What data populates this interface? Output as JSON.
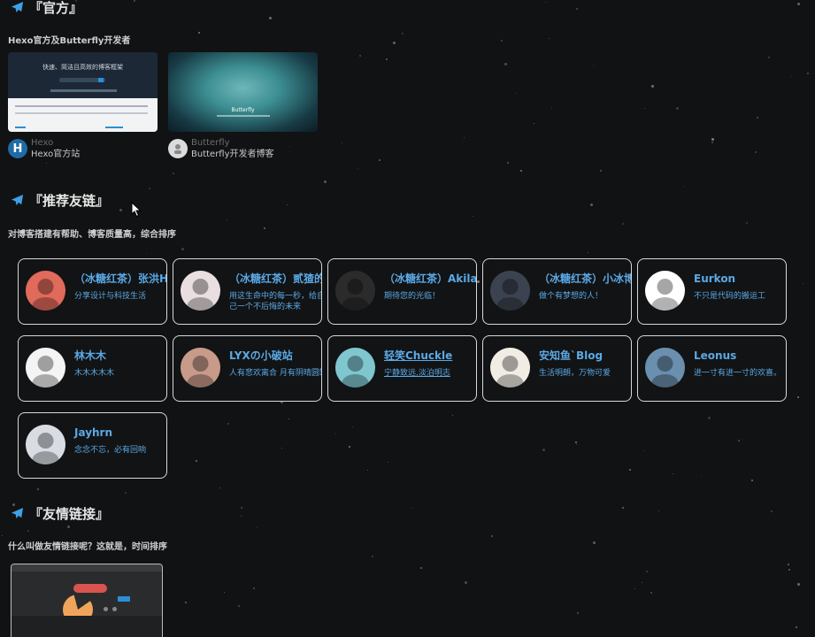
{
  "sections": {
    "official": {
      "title": "『官方』",
      "desc": "Hexo官方及Butterfly开发者",
      "cards": [
        {
          "name": "Hexo",
          "sub": "Hexo官方站",
          "thumb_heading": "快速、简洁且高效的博客框架",
          "avatar_letter": "H",
          "avatar_color": "#1f6ba5"
        },
        {
          "name": "Butterfly",
          "sub": "Butterfly开发者博客",
          "thumb_heading": "Butterfly",
          "avatar_letter": "",
          "avatar_color": "#dcdcdc"
        }
      ]
    },
    "recommended": {
      "title": "『推荐友链』",
      "desc": "对博客搭建有帮助、博客质量高，综合排序"
    },
    "friends": {
      "title": "『友情链接』",
      "desc": "什么叫做友情链接呢？这就是，时间排序"
    }
  },
  "friend_cards": [
    {
      "name": "（冰糖红茶）张洪Heo",
      "desc": "分享设计与科技生活",
      "avatar_icon": "avatar-heo-icon",
      "avatar_color": "#e06a5b"
    },
    {
      "name": "（冰糖红茶）贰猹的小窝",
      "desc": "用这生命中的每一秒，给自己一个不后悔的未来",
      "avatar_icon": "avatar-anime-girl-icon",
      "avatar_color": "#e9dfe0"
    },
    {
      "name": "（冰糖红茶）Akilar",
      "desc": "期待您的光临！",
      "avatar_icon": "avatar-akilar-icon",
      "avatar_color": "#2b2b2b"
    },
    {
      "name": "（冰糖红茶）小冰博客",
      "desc": "做个有梦想的人！",
      "avatar_icon": "avatar-anime-boy-icon",
      "avatar_color": "#3b4350"
    },
    {
      "name": "Eurkon",
      "desc": "不只是代码的搬运工",
      "avatar_icon": "avatar-eurkon-logo-icon",
      "avatar_color": "#ffffff"
    },
    {
      "name": "林木木",
      "desc": "木木木木木",
      "avatar_icon": "avatar-manga-icon",
      "avatar_color": "#f4f4f4"
    },
    {
      "name": "LYXの小破站",
      "desc": "人有悲欢离合 月有阴晴圆缺",
      "avatar_icon": "avatar-anime-girl-icon",
      "avatar_color": "#c79a8a"
    },
    {
      "name": "轻笑Chuckle",
      "desc": "宁静致远,淡泊明志",
      "avatar_icon": "avatar-miku-icon",
      "avatar_color": "#7fc6cf"
    },
    {
      "name": "安知鱼`Blog",
      "desc": "生活明朗，万物可爱",
      "avatar_icon": "avatar-laughing-icon",
      "avatar_color": "#f1ece4"
    },
    {
      "name": "Leonus",
      "desc": "进一寸有进一寸的欢喜。",
      "avatar_icon": "avatar-photo-icon",
      "avatar_color": "#6b8fae"
    },
    {
      "name": "Jayhrn",
      "desc": "念念不忘，必有回响",
      "avatar_icon": "avatar-jayhrn-icon",
      "avatar_color": "#d9dde3"
    }
  ],
  "colors": {
    "background": "#111213",
    "link": "#5aa9e6",
    "title_icon": "#3ea0e6"
  }
}
